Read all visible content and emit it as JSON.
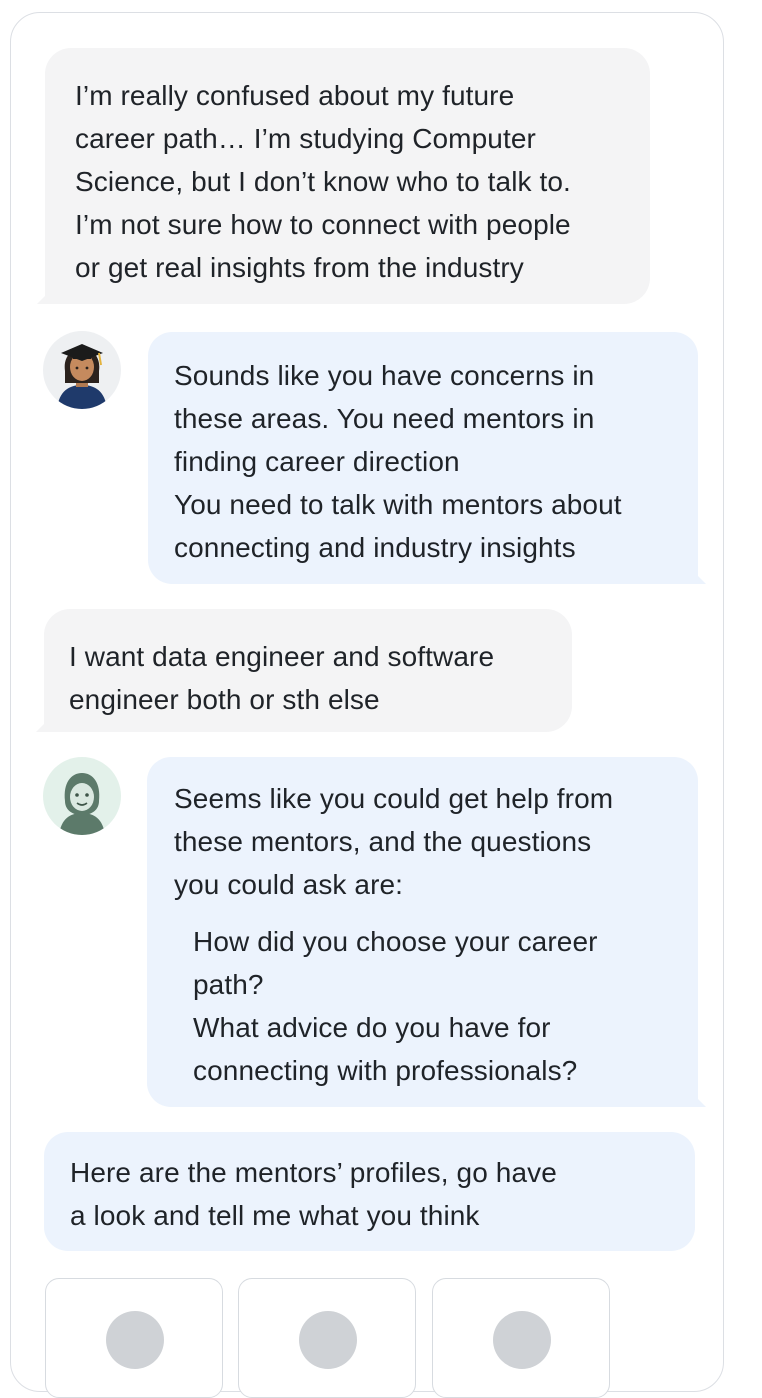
{
  "conversation": {
    "messages": [
      {
        "role": "user",
        "lines": [
          "I’m really confused about my future",
          "career path… I’m studying Computer",
          "Science, but I don’t know who to talk to.",
          "I’m not sure how to connect with people",
          "or get real insights from the industry"
        ]
      },
      {
        "role": "assistant",
        "avatar_icon": "graduate-avatar-icon",
        "lines": [
          "Sounds like you have concerns in",
          "these areas. You need mentors in",
          "finding career direction",
          "You need to talk with mentors about",
          "connecting and industry insights"
        ]
      },
      {
        "role": "user",
        "lines": [
          "I want data engineer and software",
          "engineer both or sth else"
        ]
      },
      {
        "role": "assistant",
        "avatar_icon": "assistant-avatar-icon",
        "lines": [
          "Seems like you could get help from",
          "these mentors, and the questions",
          "you could ask are:"
        ],
        "questions": [
          [
            "How did you choose your career",
            "path?"
          ],
          [
            "What advice do you have for",
            "connecting with professionals?"
          ]
        ]
      },
      {
        "role": "assistant",
        "lines": [
          "Here are the mentors’ profiles, go have",
          "a look and tell me what you think"
        ]
      }
    ],
    "mentor_cards": [
      {
        "icon": "mentor-photo-placeholder"
      },
      {
        "icon": "mentor-photo-placeholder"
      },
      {
        "icon": "mentor-photo-placeholder"
      }
    ]
  },
  "colors": {
    "user_bubble": "#f4f4f5",
    "assistant_bubble": "#ecf3fd",
    "border": "#dcdfe4",
    "text": "#1f2328"
  }
}
